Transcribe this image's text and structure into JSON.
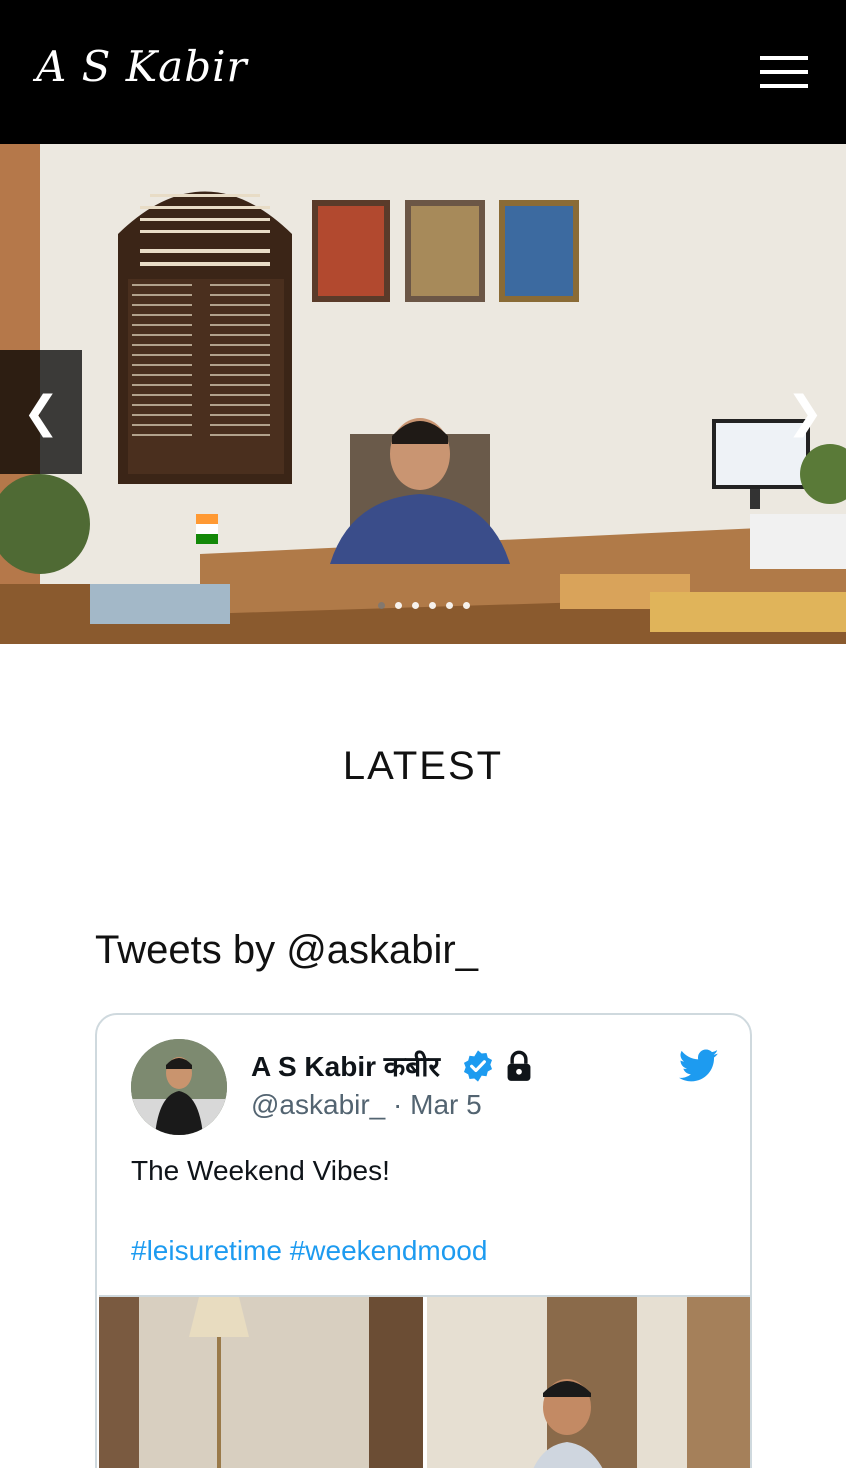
{
  "header": {
    "logo_text": "A S Kabir",
    "menu_icon": "hamburger-menu-icon"
  },
  "hero": {
    "prev_arrow": "❮",
    "next_arrow": "❯",
    "slide_count": 6,
    "active_slide": 0
  },
  "latest": {
    "heading": "LATEST"
  },
  "tweets": {
    "title": "Tweets by @askabir_",
    "tweet": {
      "author_name": "A S Kabir कबीर",
      "handle": "@askabir_",
      "date": "Mar 5",
      "handle_line": "@askabir_ · Mar 5",
      "text": "The Weekend Vibes!",
      "hashtags": [
        "#leisuretime",
        "#weekendmood"
      ],
      "verified_icon": "verified-badge-icon",
      "lock_icon": "lock-icon",
      "brand_icon": "twitter-bird-icon"
    }
  },
  "colors": {
    "header_bg": "#000000",
    "link_blue": "#1d9bf0",
    "muted_text": "#536471"
  }
}
